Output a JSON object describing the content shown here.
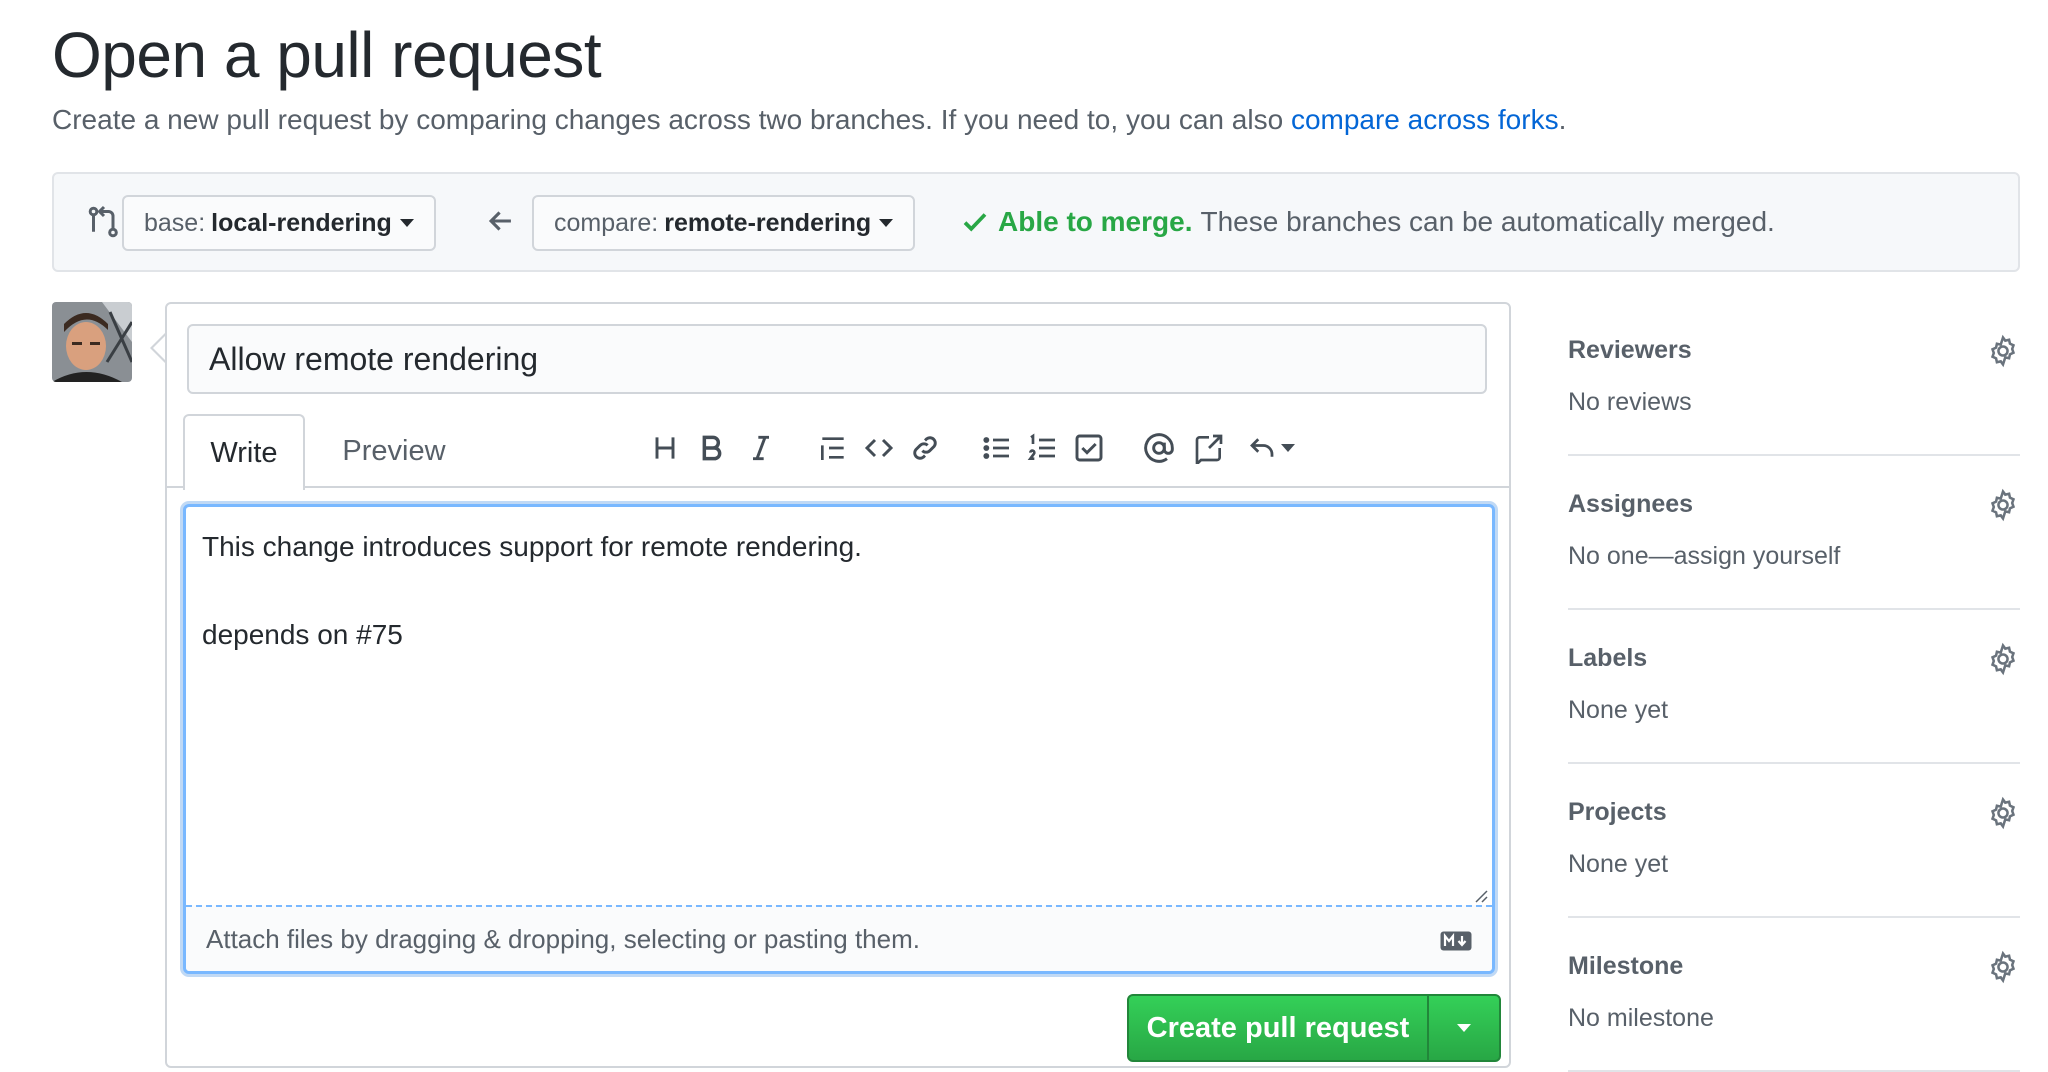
{
  "header": {
    "title": "Open a pull request",
    "subtitle": "Create a new pull request by comparing changes across two branches. If you need to, you can also",
    "subtitle_link": "compare across forks",
    "subtitle_end": "."
  },
  "range": {
    "base_label": "base:",
    "base_branch": "local-rendering",
    "compare_label": "compare:",
    "compare_branch": "remote-rendering",
    "merge_status": "Able to merge.",
    "merge_message": "These branches can be automatically merged."
  },
  "composer": {
    "title_value": "Allow remote rendering",
    "tabs": {
      "write": "Write",
      "preview": "Preview"
    },
    "body": "This change introduces support for remote rendering.\n\ndepends on #75",
    "attach_hint": "Attach files by dragging & dropping, selecting or pasting them.",
    "submit_label": "Create pull request",
    "toolbar": [
      "heading-icon",
      "bold-icon",
      "italic-icon",
      "quote-icon",
      "code-icon",
      "link-icon",
      "bulleted-list-icon",
      "numbered-list-icon",
      "task-list-icon",
      "mention-icon",
      "reference-icon",
      "reply-icon"
    ]
  },
  "sidebar": {
    "sections": [
      {
        "heading": "Reviewers",
        "value": "No reviews"
      },
      {
        "heading": "Assignees",
        "value": "No one—assign yourself"
      },
      {
        "heading": "Labels",
        "value": "None yet"
      },
      {
        "heading": "Projects",
        "value": "None yet"
      },
      {
        "heading": "Milestone",
        "value": "No milestone"
      }
    ]
  },
  "colors": {
    "link": "#0366d6",
    "success": "#28a745",
    "focus": "#79b8ff"
  }
}
